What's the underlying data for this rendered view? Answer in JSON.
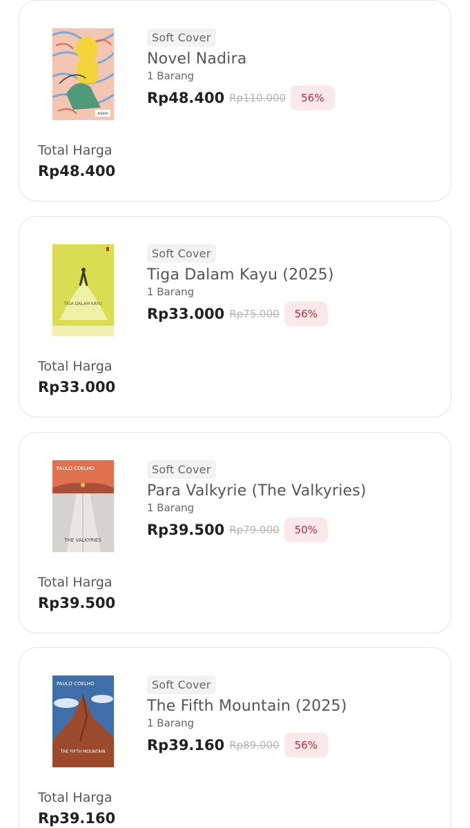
{
  "items": [
    {
      "format": "Soft Cover",
      "title": "Novel Nadira",
      "quantity": "1 Barang",
      "price": "Rp48.400",
      "original_price": "Rp110.000",
      "discount": "56%",
      "total_label": "Total Harga",
      "total": "Rp48.400",
      "cover_text": "NADIRA"
    },
    {
      "format": "Soft Cover",
      "title": "Tiga Dalam Kayu (2025)",
      "quantity": "1 Barang",
      "price": "Rp33.000",
      "original_price": "Rp75.000",
      "discount": "56%",
      "total_label": "Total Harga",
      "total": "Rp33.000",
      "cover_text": "TIGA DALAM KAYU"
    },
    {
      "format": "Soft Cover",
      "title": "Para Valkyrie (The Valkyries)",
      "quantity": "1 Barang",
      "price": "Rp39.500",
      "original_price": "Rp79.000",
      "discount": "50%",
      "total_label": "Total Harga",
      "total": "Rp39.500",
      "cover_author": "PAULO COELHO",
      "cover_text": "THE VALKYRIES"
    },
    {
      "format": "Soft Cover",
      "title": "The Fifth Mountain (2025)",
      "quantity": "1 Barang",
      "price": "Rp39.160",
      "original_price": "Rp89.000",
      "discount": "56%",
      "total_label": "Total Harga",
      "total": "Rp39.160",
      "cover_author": "PAULO COELHO",
      "cover_text": "THE FIFTH MOUNTAIN"
    }
  ]
}
